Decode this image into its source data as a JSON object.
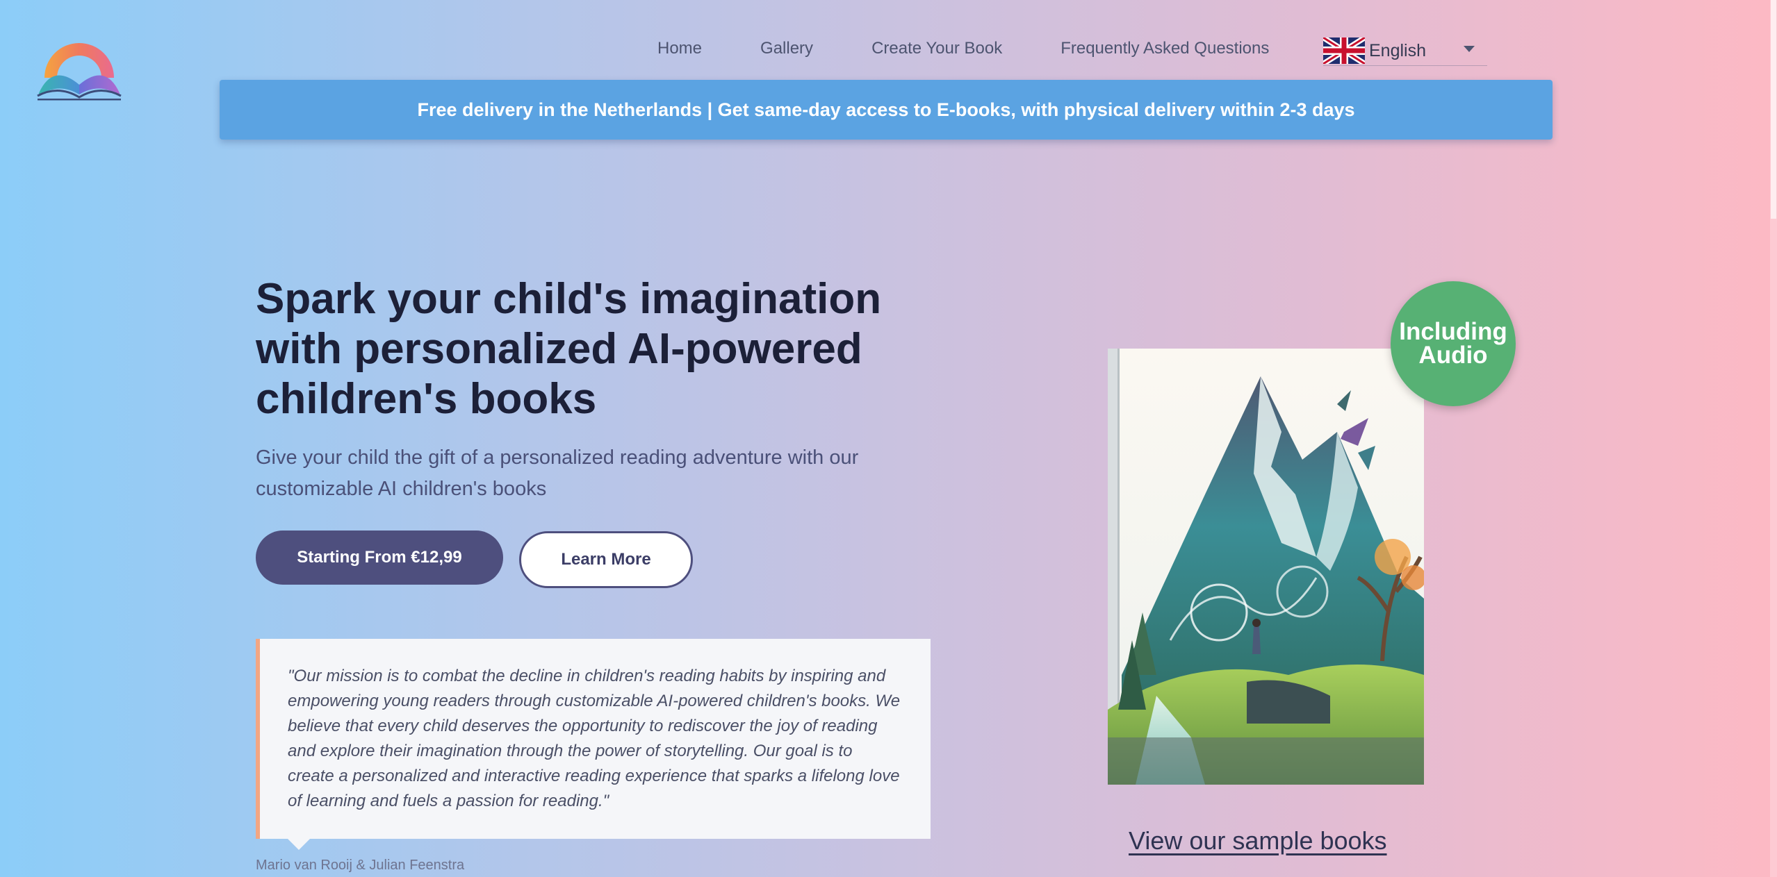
{
  "header": {
    "logo_icon": "rainbow-book-logo-icon",
    "nav": [
      "Home",
      "Gallery",
      "Create Your Book",
      "Frequently Asked Questions"
    ],
    "language": {
      "flag_icon": "uk-flag-icon",
      "label": "English",
      "caret_icon": "caret-down-icon"
    }
  },
  "banner": {
    "text": "Free delivery in the Netherlands | Get same-day access to E-books, with physical delivery within 2-3 days"
  },
  "hero": {
    "title": "Spark your child's imagination with personalized AI-powered children's books",
    "subtitle": "Give your child the gift of a personalized reading adventure with our customizable AI children's books",
    "primary_button": "Starting From €12,99",
    "secondary_button": "Learn More"
  },
  "quote": {
    "text": "\"Our mission is to combat the decline in children's reading habits by inspiring and empowering young readers through customizable AI-powered children's books. We believe that every child deserves the opportunity to rediscover the joy of reading and explore their imagination through the power of storytelling. Our goal is to create a personalized and interactive reading experience that sparks a lifelong love of learning and fuels a passion for reading.\"",
    "author": "Mario van Rooij & Julian Feenstra"
  },
  "showcase": {
    "badge_line1": "Including",
    "badge_line2": "Audio",
    "cover_icon": "mountain-waterfall-book-cover",
    "link": "View our sample books"
  },
  "colors": {
    "banner": "#5ba3e2",
    "primary_button": "#4e4f7e",
    "badge": "#57b174",
    "quote_accent": "#f2a683"
  }
}
